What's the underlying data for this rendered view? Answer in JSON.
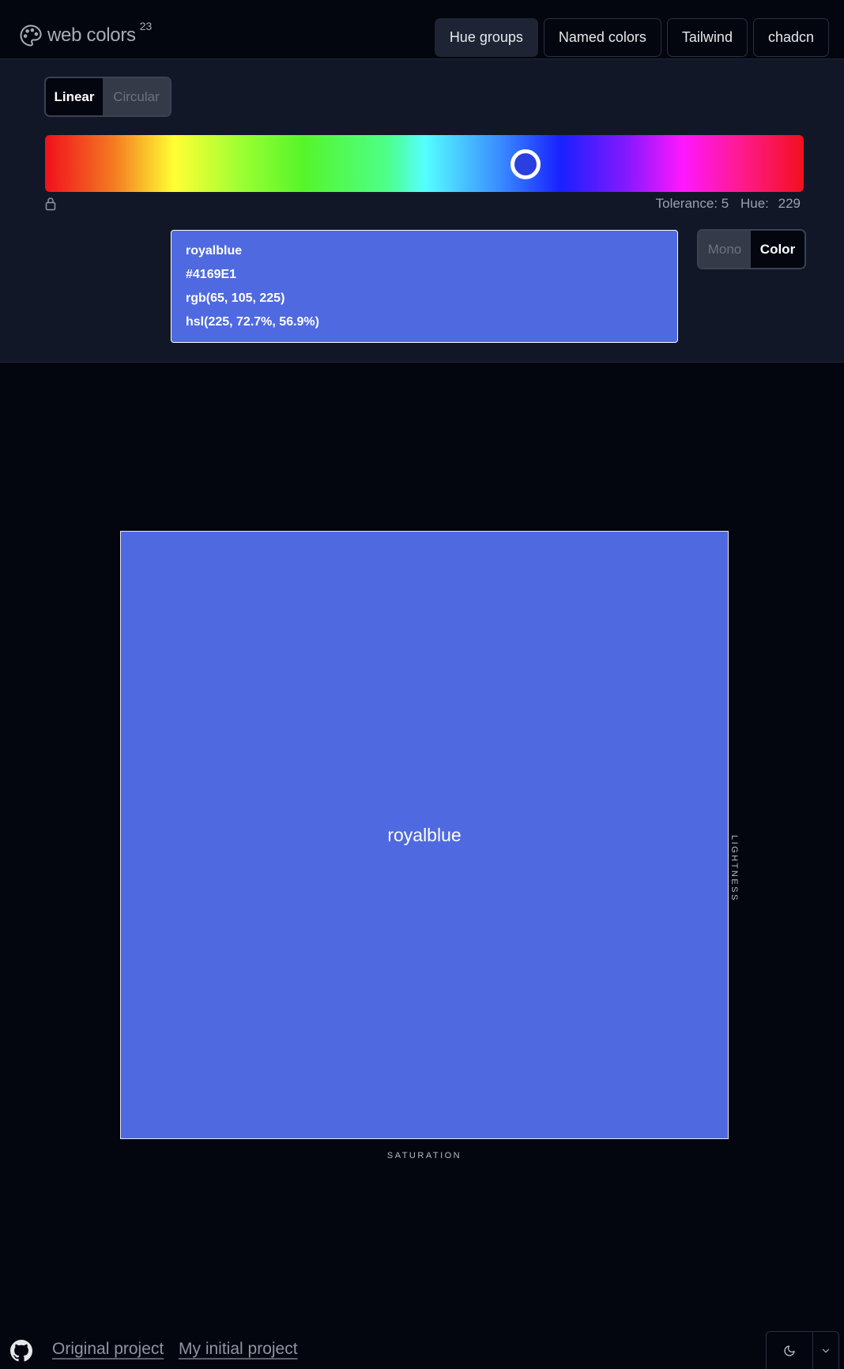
{
  "header": {
    "logo_text": "web colors",
    "logo_sup": "23",
    "nav": [
      {
        "label": "Hue groups",
        "active": true
      },
      {
        "label": "Named colors",
        "active": false
      },
      {
        "label": "Tailwind",
        "active": false
      },
      {
        "label": "chadcn",
        "active": false
      }
    ]
  },
  "controls": {
    "layout_toggle": {
      "linear": "Linear",
      "circular": "Circular",
      "selected": "Linear"
    },
    "tolerance_label": "Tolerance: 5",
    "hue_label": "Hue:",
    "hue_value": "229",
    "mode_toggle": {
      "mono": "Mono",
      "color": "Color",
      "selected": "Color"
    }
  },
  "selected_color": {
    "name": "royalblue",
    "hex": "#4169E1",
    "rgb": "rgb(65, 105, 225)",
    "hsl": "hsl(225, 72.7%, 56.9%)",
    "fill": "#4f6ae0"
  },
  "plot": {
    "label": "royalblue",
    "x_axis": "SATURATION",
    "y_axis": "LIGHTNESS"
  },
  "footer": {
    "link1": "Original project",
    "link2": "My initial project"
  },
  "colors": {
    "page_bg": "#03050f",
    "panel_bg": "#111727",
    "swatch": "#4f6ae0"
  }
}
